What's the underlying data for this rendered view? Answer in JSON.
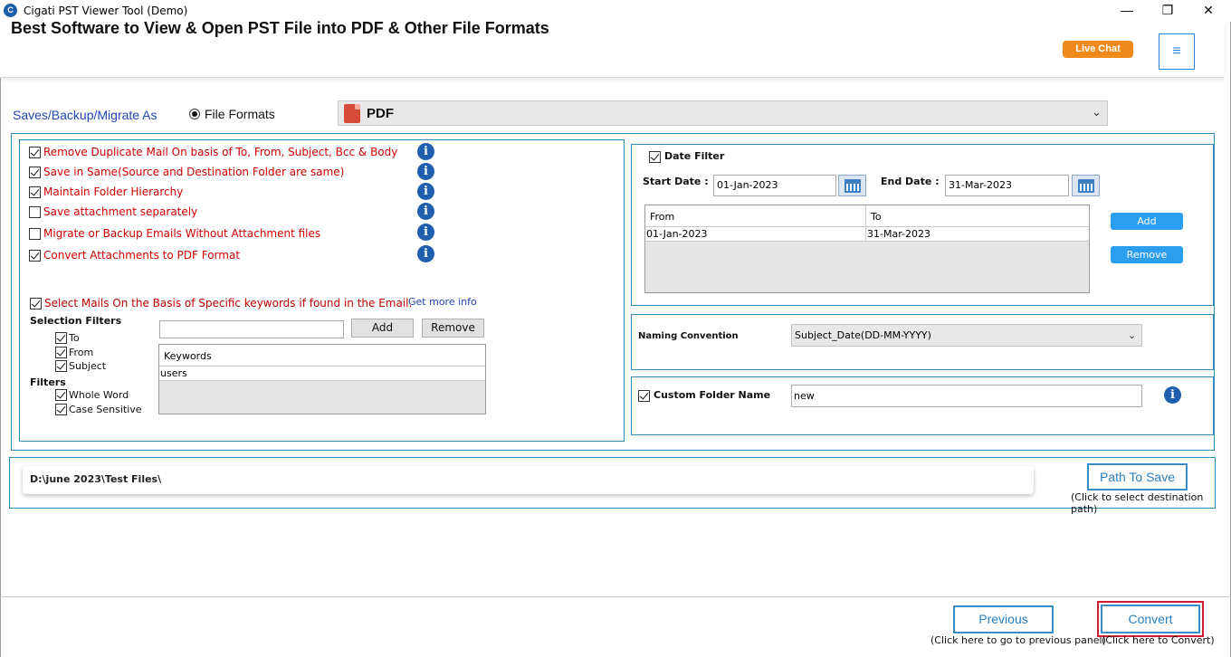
{
  "window": {
    "title": "Cigati PST Viewer Tool (Demo)",
    "app_icon_letter": "C",
    "minimize": "—",
    "maximize": "❐",
    "close": "✕"
  },
  "header": {
    "title": "Best Software to View & Open PST File into PDF & Other File Formats",
    "live_chat": "Live Chat",
    "menu_icon": "≡"
  },
  "saves": {
    "label": "Saves/Backup/Migrate As",
    "radio_label": "File Formats",
    "selected_format": "PDF"
  },
  "options": [
    {
      "label": "Remove Duplicate Mail On basis of To, From, Subject, Bcc & Body",
      "checked": true
    },
    {
      "label": "Save in Same(Source and Destination Folder are same)",
      "checked": true
    },
    {
      "label": "Maintain Folder Hierarchy",
      "checked": true
    },
    {
      "label": "Save attachment separately",
      "checked": false
    },
    {
      "label": "Migrate or Backup Emails Without Attachment files",
      "checked": false
    },
    {
      "label": "Convert Attachments to PDF Format",
      "checked": true
    }
  ],
  "info_glyph": "i",
  "keywords": {
    "select_label": "Select Mails On the Basis of Specific keywords if found in the Email.",
    "get_more_info": "Get more info",
    "selection_filters_label": "Selection Filters",
    "selection_filters": [
      "To",
      "From",
      "Subject"
    ],
    "filters_label": "Filters",
    "filters": [
      "Whole Word",
      "Case Sensitive"
    ],
    "input_value": "",
    "add_label": "Add",
    "remove_label": "Remove",
    "table_header": "Keywords",
    "rows": [
      "users"
    ]
  },
  "date_filter": {
    "label": "Date Filter",
    "start_label": "Start Date :",
    "start_value": "01-Jan-2023",
    "end_label": "End Date :",
    "end_value": "31-Mar-2023",
    "col_from": "From",
    "col_to": "To",
    "row_from": "01-Jan-2023",
    "row_to": "31-Mar-2023",
    "add_label": "Add",
    "remove_label": "Remove"
  },
  "naming": {
    "label": "Naming Convention",
    "value": "Subject_Date(DD-MM-YYYY)"
  },
  "custom_folder": {
    "label": "Custom Folder Name",
    "value": "new"
  },
  "path": {
    "value": "D:\\june 2023\\Test Files\\",
    "button_label": "Path To Save",
    "hint": "(Click to select destination path)"
  },
  "footer": {
    "previous_label": "Previous",
    "previous_hint": "(Click here to go to previous panel)",
    "convert_label": "Convert",
    "convert_hint": "(Click here to Convert)"
  },
  "colors": {
    "accent": "#2d8bb5",
    "option_red": "#d00000",
    "live_chat": "#f08a1c",
    "convert_frame": "#d01f2f"
  }
}
